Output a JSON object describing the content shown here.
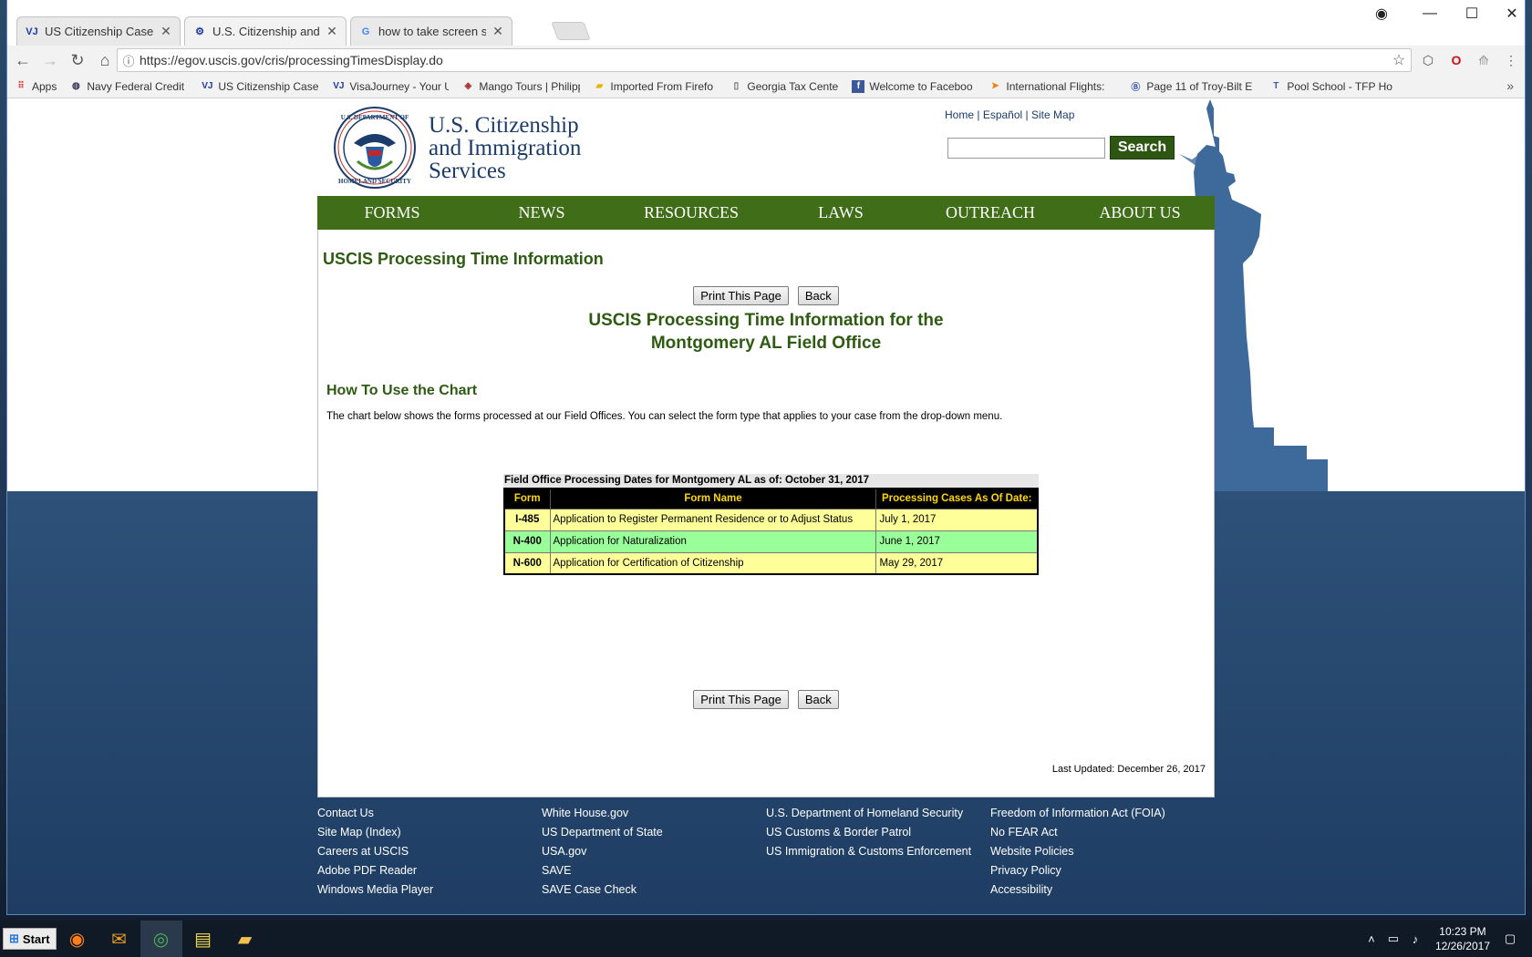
{
  "browser": {
    "tabs": [
      {
        "title": "US Citizenship Case Filin",
        "icon": "visajourney-icon",
        "active": false
      },
      {
        "title": "U.S. Citizenship and Imm",
        "icon": "dhs-seal-icon",
        "active": true
      },
      {
        "title": "how to take screen shot",
        "icon": "google-icon",
        "active": false
      }
    ],
    "url": "https://egov.uscis.gov/cris/processingTimesDisplay.do",
    "bookmarks": [
      {
        "label": "Apps",
        "icon": "apps-grid-icon"
      },
      {
        "label": "Navy Federal Credit U",
        "icon": "globe-icon"
      },
      {
        "label": "US Citizenship Case F",
        "icon": "visajourney-icon"
      },
      {
        "label": "VisaJourney - Your U",
        "icon": "visajourney-icon"
      },
      {
        "label": "Mango Tours | Philipp",
        "icon": "mango-icon"
      },
      {
        "label": "Imported From Firefo",
        "icon": "folder-icon"
      },
      {
        "label": "Georgia Tax Center",
        "icon": "page-icon"
      },
      {
        "label": "Welcome to Faceboo",
        "icon": "facebook-icon"
      },
      {
        "label": "International Flights:",
        "icon": "flight-icon"
      },
      {
        "label": "Page 11 of Troy-Bilt E",
        "icon": "page-b-icon"
      },
      {
        "label": "Pool School - TFP Ho",
        "icon": "tfp-icon"
      }
    ]
  },
  "header": {
    "agency_line1": "U.S. Citizenship",
    "agency_line2": "and Immigration",
    "agency_line3": "Services",
    "top_links": [
      "Home",
      "Español",
      "Site Map"
    ],
    "search_button": "Search",
    "search_value": ""
  },
  "nav": [
    "FORMS",
    "NEWS",
    "RESOURCES",
    "LAWS",
    "OUTREACH",
    "ABOUT US"
  ],
  "content": {
    "heading": "USCIS Processing Time Information",
    "print_button": "Print This Page",
    "back_button": "Back",
    "subtitle_line1": "USCIS Processing Time Information for the",
    "subtitle_line2": "Montgomery AL Field Office",
    "howto_heading": "How To Use the Chart",
    "howto_text": "The chart below shows the forms processed at our Field Offices. You can select the form type that applies to your case from the drop-down menu.",
    "table_caption": "Field Office Processing Dates for Montgomery AL as of: October 31, 2017",
    "table_headers": [
      "Form",
      "Form Name",
      "Processing Cases As Of Date:"
    ],
    "table_rows": [
      {
        "form": "I-485",
        "name": "Application to Register Permanent Residence or to Adjust Status",
        "date": "July 1, 2017"
      },
      {
        "form": "N-400",
        "name": "Application for Naturalization",
        "date": "June 1, 2017"
      },
      {
        "form": "N-600",
        "name": "Application for Certification of Citizenship",
        "date": "May 29, 2017"
      }
    ],
    "last_updated": "Last Updated: December 26, 2017"
  },
  "footer": {
    "col1": [
      "Contact Us",
      "Site Map (Index)",
      "Careers at USCIS",
      "Adobe PDF Reader",
      "Windows Media Player"
    ],
    "col2": [
      "White House.gov",
      "US Department of State",
      "USA.gov",
      "SAVE",
      "SAVE Case Check"
    ],
    "col3": [
      "U.S. Department of Homeland Security",
      "US Customs & Border Patrol",
      "US Immigration & Customs Enforcement"
    ],
    "col4": [
      "Freedom of Information Act (FOIA)",
      "No FEAR Act",
      "Website Policies",
      "Privacy Policy",
      "Accessibility"
    ]
  },
  "taskbar": {
    "start_label": "Start",
    "apps": [
      "firefox-icon",
      "mail-icon",
      "chrome-icon",
      "sticky-notes-icon",
      "file-explorer-icon"
    ],
    "time": "10:23 PM",
    "date": "12/26/2017"
  },
  "colors": {
    "nav_green": "#3f6d18",
    "heading_green": "#2e5b12",
    "row_yellow": "#ffff99",
    "row_green": "#99ff99",
    "header_gold": "#ffd700"
  }
}
